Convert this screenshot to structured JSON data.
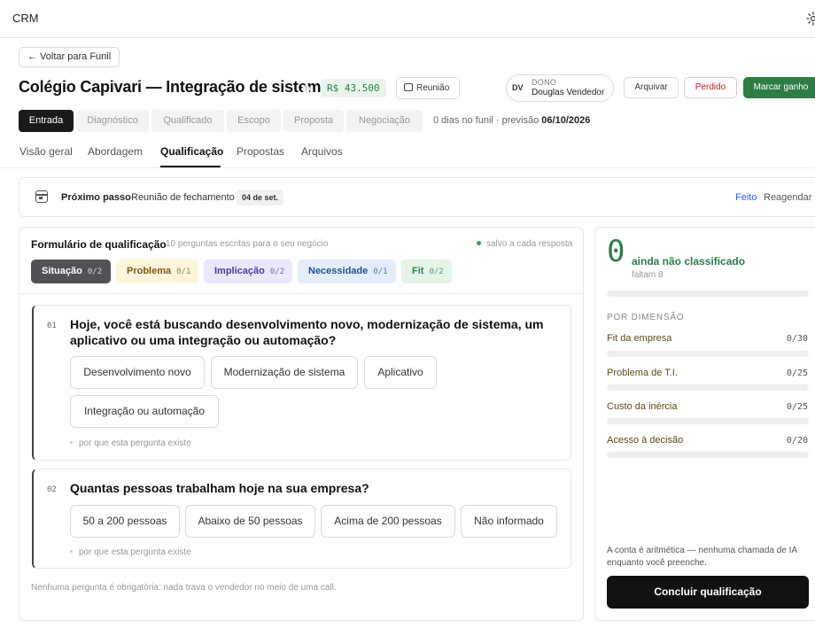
{
  "header": {
    "app_title": "CRM",
    "settings_icon": "gear-icon"
  },
  "deal": {
    "back_label": "← Voltar para Funil",
    "title": "Colégio Capivari — Integração de sistemas",
    "help": "?",
    "amount": "R$ 43.500",
    "meeting_label": "Reunião",
    "owner": {
      "initials": "DV",
      "label": "DONO",
      "name": "Douglas Vendedor"
    },
    "actions": {
      "archive": "Arquivar",
      "lost": "Perdido",
      "won": "Marcar ganho"
    },
    "colors": {
      "won": "#2e7d45",
      "lost": "#b3261e"
    }
  },
  "stages": {
    "items": [
      "Entrada",
      "Diagnóstico",
      "Qualificado",
      "Escopo",
      "Proposta",
      "Negociação"
    ],
    "active_index": 0,
    "info_prefix": "0 dias no funil · previsão",
    "forecast_date": "06/10/2026"
  },
  "tabs": {
    "items": [
      "Visão geral",
      "Abordagem",
      "Qualificação",
      "Propostas",
      "Arquivos"
    ],
    "active_index": 2
  },
  "next_step": {
    "label": "Próximo passo",
    "text": "Reunião de fechamento",
    "date": "04 de set.",
    "done": "Feito",
    "reschedule": "Reagendar"
  },
  "form": {
    "title": "Formulário de qualificação",
    "subtitle": "10 perguntas escritas para o seu negócio",
    "saved": "salvo a cada resposta",
    "chips": [
      {
        "label": "Situação",
        "count": "0/2"
      },
      {
        "label": "Problema",
        "count": "0/1"
      },
      {
        "label": "Implicação",
        "count": "0/2"
      },
      {
        "label": "Necessidade",
        "count": "0/1"
      },
      {
        "label": "Fit",
        "count": "0/2"
      }
    ],
    "questions": [
      {
        "num": "01",
        "text": "Hoje, você está buscando desenvolvimento novo, modernização de sistema, um aplicativo ou uma integração ou automação?",
        "options": [
          "Desenvolvimento novo",
          "Modernização de sistema",
          "Aplicativo",
          "Integração ou automação"
        ],
        "why": "por que esta pergunta existe"
      },
      {
        "num": "02",
        "text": "Quantas pessoas trabalham hoje na sua empresa?",
        "options": [
          "50 a 200 pessoas",
          "Abaixo de 50 pessoas",
          "Acima de 200 pessoas",
          "Não informado"
        ],
        "why": "por que esta pergunta existe"
      }
    ],
    "footer": "Nenhuma pergunta é obrigatória: nada trava o vendedor no meio de uma call."
  },
  "score": {
    "value": "0",
    "status": "ainda não classificado",
    "remaining": "faltam 8",
    "progress": 0,
    "dimensions_title": "POR DIMENSÃO",
    "dimensions": [
      {
        "label": "Fit da empresa",
        "score": "0/30",
        "progress": 0
      },
      {
        "label": "Problema de T.I.",
        "score": "0/25",
        "progress": 0
      },
      {
        "label": "Custo da inércia",
        "score": "0/25",
        "progress": 0
      },
      {
        "label": "Acesso à decisão",
        "score": "0/20",
        "progress": 0
      }
    ],
    "note": "A conta é aritmética — nenhuma chamada de IA enquanto você preenche.",
    "conclude": "Concluir qualificação"
  }
}
